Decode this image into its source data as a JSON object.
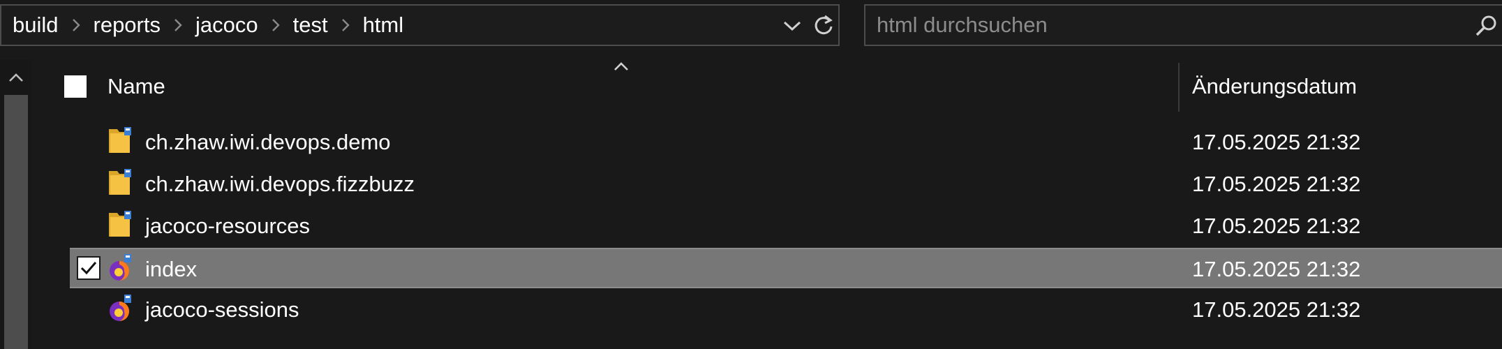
{
  "breadcrumb": [
    "build",
    "reports",
    "jacoco",
    "test",
    "html"
  ],
  "search": {
    "placeholder": "html durchsuchen",
    "value": ""
  },
  "columns": {
    "name": "Name",
    "modified": "Änderungsdatum"
  },
  "files": [
    {
      "name": "ch.zhaw.iwi.devops.demo",
      "modified": "17.05.2025 21:32",
      "icon": "folder-icon",
      "selected": false
    },
    {
      "name": "ch.zhaw.iwi.devops.fizzbuzz",
      "modified": "17.05.2025 21:32",
      "icon": "folder-icon",
      "selected": false
    },
    {
      "name": "jacoco-resources",
      "modified": "17.05.2025 21:32",
      "icon": "folder-icon",
      "selected": false
    },
    {
      "name": "index",
      "modified": "17.05.2025 21:32",
      "icon": "firefox-html-icon",
      "selected": true
    },
    {
      "name": "jacoco-sessions",
      "modified": "17.05.2025 21:32",
      "icon": "firefox-html-icon",
      "selected": false
    }
  ],
  "colors": {
    "background": "#191919",
    "selected_row": "#777777",
    "folder": "#f5c244",
    "border": "#4c4c4c"
  }
}
